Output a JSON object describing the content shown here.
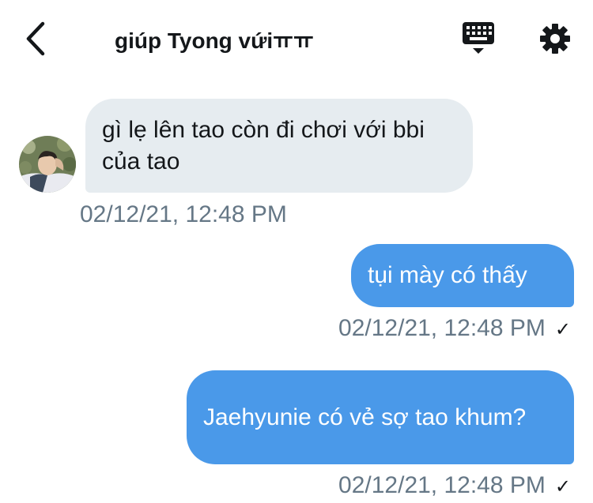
{
  "header": {
    "title": "giúp Tyong vứiㅠㅠ",
    "back_icon": "chevron-left-icon",
    "keyboard_icon": "keyboard-icon",
    "settings_icon": "gear-icon"
  },
  "messages": [
    {
      "direction": "incoming",
      "text": "gì lẹ lên tao còn đi chơi với bbi của tao",
      "timestamp": "02/12/21, 12:48 PM"
    },
    {
      "direction": "outgoing",
      "text": "tụi mày có thấy",
      "timestamp": "02/12/21, 12:48 PM",
      "status_mark": "✓"
    },
    {
      "direction": "outgoing",
      "text": "Jaehyunie có vẻ sợ tao khum?",
      "timestamp": "02/12/21, 12:48 PM",
      "status_mark": "✓"
    }
  ],
  "colors": {
    "incoming_bubble": "#e6ecf0",
    "outgoing_bubble": "#4a99e9",
    "timestamp_text": "#657786",
    "primary_text": "#14171a"
  }
}
